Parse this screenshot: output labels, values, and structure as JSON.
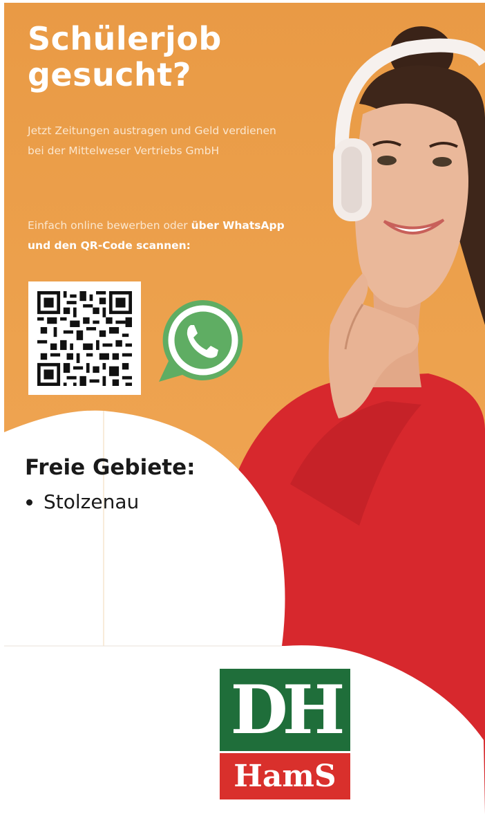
{
  "headline": "Schülerjob gesucht?",
  "intro": "Jetzt Zeitungen austragen und Geld verdienen bei der Mittelweser Vertriebs GmbH",
  "cta": {
    "lead": "Einfach online bewerben oder ",
    "bold": "über WhatsApp und den QR-Code scannen:"
  },
  "areas": {
    "title": "Freie Gebiete:",
    "items": [
      "Stolzenau"
    ]
  },
  "logo": {
    "top_text": "DH",
    "bottom_text": "HamS"
  },
  "icons": {
    "qr": "qr-code-icon",
    "whatsapp": "whatsapp-icon"
  },
  "colors": {
    "orange": "#ec9f4b",
    "whatsapp_green": "#5fad63",
    "logo_green": "#1f6e3a",
    "logo_red": "#d9302c",
    "sweater_red": "#d7282d"
  }
}
